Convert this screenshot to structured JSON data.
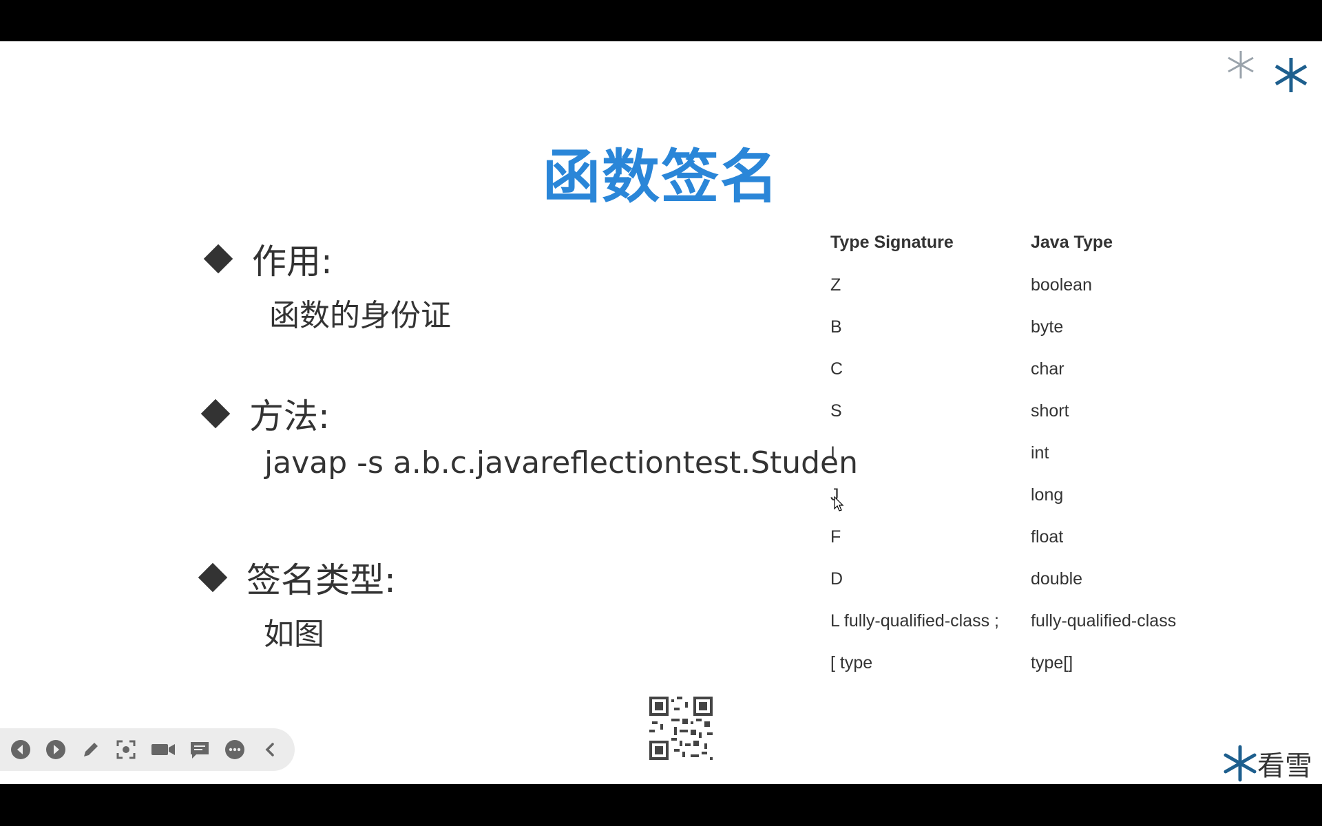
{
  "slide": {
    "title": "函数签名",
    "bullets": [
      {
        "label": "作用:",
        "detail": "函数的身份证"
      },
      {
        "label": "方法:",
        "detail": "javap -s a.b.c.javareflectiontest.Studen"
      },
      {
        "label": "签名类型:",
        "detail": "如图"
      }
    ]
  },
  "signature_table": {
    "headers": [
      "Type Signature",
      "Java Type"
    ],
    "rows": [
      [
        "Z",
        "boolean"
      ],
      [
        "B",
        "byte"
      ],
      [
        "C",
        "char"
      ],
      [
        "S",
        "short"
      ],
      [
        "I",
        "int"
      ],
      [
        "J",
        "long"
      ],
      [
        "F",
        "float"
      ],
      [
        "D",
        "double"
      ],
      [
        "L fully-qualified-class ;",
        "fully-qualified-class"
      ],
      [
        "[ type",
        "type[]"
      ]
    ]
  },
  "branding": {
    "logo_text": "看雪",
    "accent_color": "#2a86d8"
  },
  "toolbar": {
    "icons": [
      "previous-icon",
      "next-icon",
      "pen-icon",
      "screenshot-icon",
      "camera-icon",
      "comment-icon",
      "more-icon",
      "collapse-icon"
    ]
  }
}
